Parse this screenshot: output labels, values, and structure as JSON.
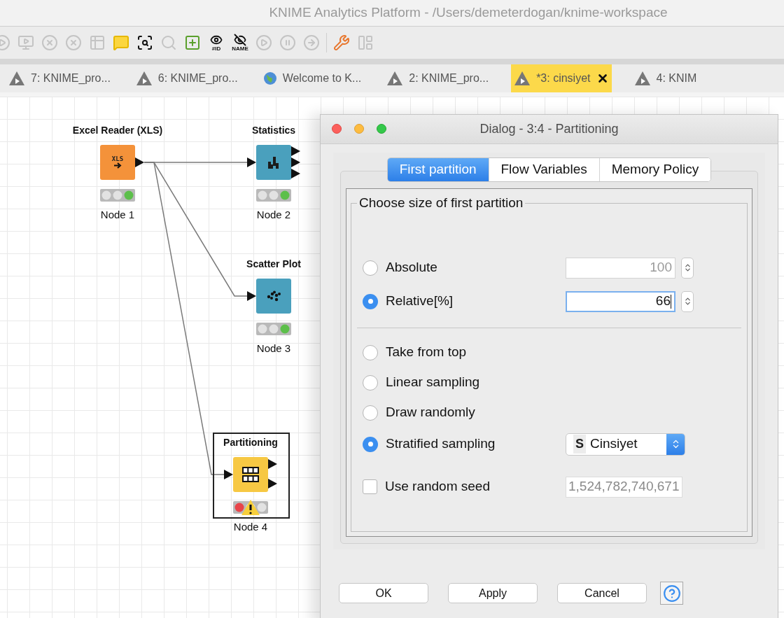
{
  "window": {
    "title": "KNIME Analytics Platform - /Users/demeterdogan/knime-workspace"
  },
  "toolbar": [
    {
      "kind": "execute",
      "disabled": true
    },
    {
      "kind": "execute-all",
      "disabled": true
    },
    {
      "kind": "cancel",
      "disabled": true
    },
    {
      "kind": "cancel-all",
      "disabled": true
    },
    {
      "kind": "reset",
      "disabled": true
    },
    {
      "kind": "comment",
      "disabled": false
    },
    {
      "kind": "inspect",
      "disabled": false
    },
    {
      "kind": "search",
      "disabled": true
    },
    {
      "kind": "add",
      "disabled": false
    },
    {
      "kind": "show-id",
      "label": "#ID",
      "disabled": false
    },
    {
      "kind": "show-name",
      "label": "NAME",
      "disabled": false
    },
    {
      "kind": "step",
      "disabled": true
    },
    {
      "kind": "pause",
      "disabled": true
    },
    {
      "kind": "resume",
      "disabled": true
    },
    {
      "kind": "configure",
      "disabled": false
    },
    {
      "kind": "layout",
      "disabled": true
    }
  ],
  "editor_tabs": [
    {
      "label": "7: KNIME_pro...",
      "kind": "workflow",
      "selected": false
    },
    {
      "label": "6: KNIME_pro...",
      "kind": "workflow",
      "selected": false
    },
    {
      "label": "Welcome to K...",
      "kind": "web",
      "selected": false
    },
    {
      "label": "2: KNIME_pro...",
      "kind": "workflow",
      "selected": false
    },
    {
      "label": "*3: cinsiyet",
      "kind": "workflow",
      "selected": true
    },
    {
      "label": "4: KNIM",
      "kind": "workflow",
      "selected": false
    }
  ],
  "workflow": {
    "nodes": [
      {
        "name": "Excel Reader (XLS)",
        "label": "Node 1",
        "kind": "reader",
        "icon_text": "XLS",
        "executed": true,
        "warning": false,
        "selected": false
      },
      {
        "name": "Statistics",
        "label": "Node 2",
        "kind": "statistics",
        "executed": true,
        "warning": false,
        "selected": false
      },
      {
        "name": "Scatter Plot",
        "label": "Node 3",
        "kind": "scatter",
        "executed": true,
        "warning": false,
        "selected": false
      },
      {
        "name": "Partitioning",
        "label": "Node 4",
        "kind": "partitioning",
        "executed": false,
        "warning": true,
        "selected": true
      }
    ]
  },
  "dialog": {
    "title": "Dialog - 3:4 - Partitioning",
    "tabs": [
      {
        "label": "First partition",
        "selected": true
      },
      {
        "label": "Flow Variables",
        "selected": false
      },
      {
        "label": "Memory Policy",
        "selected": false
      }
    ],
    "group_title": "Choose size of first partition",
    "size_options": [
      {
        "label": "Absolute",
        "selected": false,
        "value": "100",
        "disabled": true,
        "focused": false
      },
      {
        "label": "Relative[%]",
        "selected": true,
        "value": "66",
        "disabled": false,
        "focused": true
      }
    ],
    "sampling_options": [
      {
        "label": "Take from top",
        "selected": false
      },
      {
        "label": "Linear sampling",
        "selected": false
      },
      {
        "label": "Draw randomly",
        "selected": false
      },
      {
        "label": "Stratified sampling",
        "selected": true,
        "column": {
          "type": "S",
          "value": "Cinsiyet"
        }
      }
    ],
    "random_seed": {
      "label": "Use random seed",
      "checked": false,
      "value": "1,524,782,740,671",
      "disabled": true
    },
    "buttons": [
      "OK",
      "Apply",
      "Cancel"
    ]
  }
}
